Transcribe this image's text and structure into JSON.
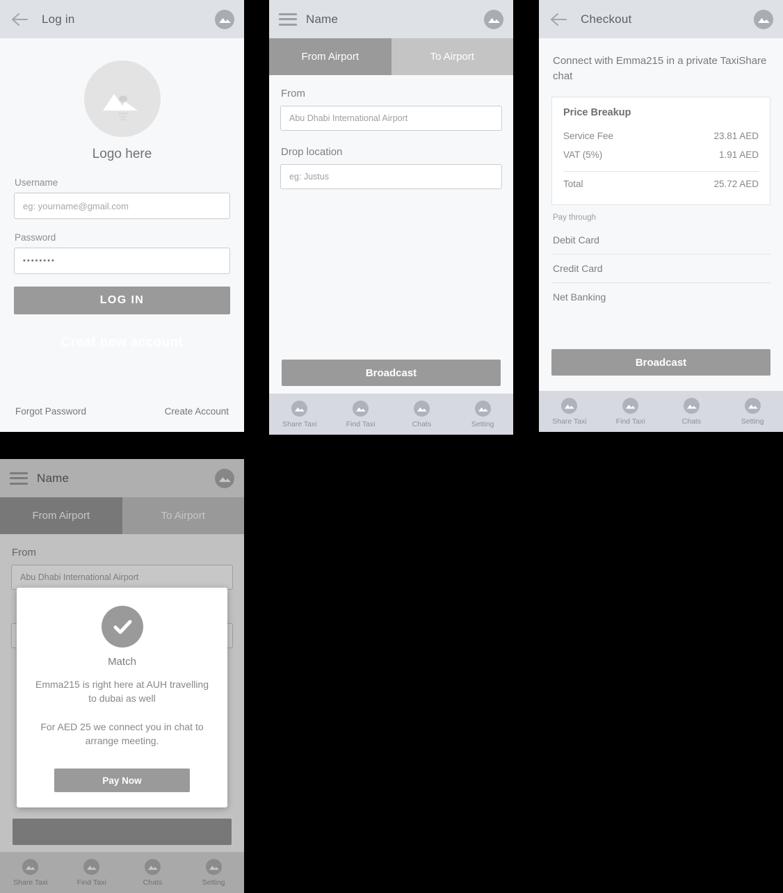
{
  "icons": {
    "back": "arrow-left-icon",
    "menu": "hamburger-menu-icon",
    "avatar": "image-placeholder-avatar-icon",
    "logo": "image-placeholder-logo-icon",
    "check": "check-circle-icon"
  },
  "colors": {
    "appbar_bg": "#dee1e6",
    "page_bg": "#f7f8fa",
    "primary_button": "#9a9a9a",
    "tab_active": "#9a9a9a",
    "tab_inactive": "#c4c4c4",
    "bottomnav_bg": "#d6d9e0",
    "field_border": "#c9cbcf",
    "text_muted": "#8a8d91",
    "canvas_bg": "#000000"
  },
  "login": {
    "appbar": {
      "title": "Log in"
    },
    "logo_label": "Logo here",
    "username": {
      "label": "Username",
      "placeholder": "eg: yourname@gmail.com",
      "value": ""
    },
    "password": {
      "label": "Password",
      "placeholder": "",
      "value": "••••••••"
    },
    "login_button": "LOG IN",
    "create_new_account": "Creat new account",
    "footer": {
      "forgot_password": "Forgot Password",
      "create_account": "Create Account"
    }
  },
  "search": {
    "appbar": {
      "title": "Name"
    },
    "tabs": [
      {
        "label": "From Airport",
        "active": true
      },
      {
        "label": "To Airport",
        "active": false
      }
    ],
    "from": {
      "label": "From",
      "value": "Abu Dhabi International Airport"
    },
    "drop": {
      "label": "Drop location",
      "placeholder": "eg: Justus",
      "value": ""
    },
    "broadcast_button": "Broadcast"
  },
  "checkout": {
    "appbar": {
      "title": "Checkout"
    },
    "intro": "Connect with Emma215 in a private TaxiShare chat",
    "price_breakup": {
      "title": "Price Breakup",
      "rows": [
        {
          "label": "Service Fee",
          "amount": "23.81 AED"
        },
        {
          "label": "VAT (5%)",
          "amount": "1.91 AED"
        }
      ],
      "total": {
        "label": "Total",
        "amount": "25.72 AED"
      }
    },
    "pay_through_label": "Pay through",
    "pay_options": [
      {
        "label": "Debit Card"
      },
      {
        "label": "Credit Card"
      },
      {
        "label": "Net Banking"
      }
    ],
    "broadcast_button": "Broadcast"
  },
  "match": {
    "appbar": {
      "title": "Name"
    },
    "tabs": [
      {
        "label": "From Airport",
        "active": true
      },
      {
        "label": "To Airport",
        "active": false
      }
    ],
    "from": {
      "label": "From",
      "value": "Abu Dhabi International Airport"
    },
    "dialog": {
      "title": "Match",
      "line1": "Emma215 is right here at AUH travelling to dubai as well",
      "line2": "For AED 25 we connect you in chat to arrange meeting.",
      "button": "Pay Now"
    }
  },
  "bottom_nav": {
    "items": [
      {
        "label": "Share Taxi",
        "icon": "share-taxi-icon"
      },
      {
        "label": "Find Taxi",
        "icon": "find-taxi-icon"
      },
      {
        "label": "Chats",
        "icon": "chats-icon"
      },
      {
        "label": "Setting",
        "icon": "setting-icon"
      }
    ]
  }
}
